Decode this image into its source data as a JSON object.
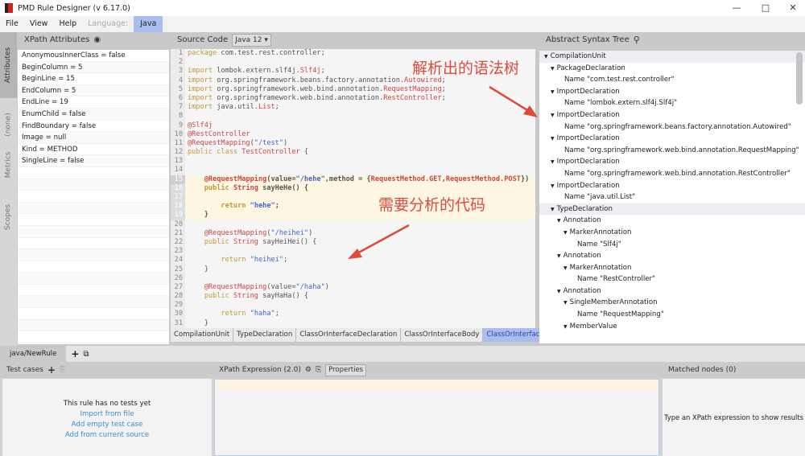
{
  "window": {
    "title": "PMD Rule Designer (v 6.17.0)"
  },
  "menu": {
    "file": "File",
    "view": "View",
    "help": "Help",
    "language_label": "Language:",
    "language": "Java"
  },
  "side_tabs": [
    "Attributes",
    "(none)",
    "Metrics",
    "Scopes"
  ],
  "attributes": {
    "title": "XPath Attributes",
    "items": [
      "AnonymousInnerClass = false",
      "BeginColumn = 5",
      "BeginLine = 15",
      "EndColumn = 5",
      "EndLine = 19",
      "EnumChild = false",
      "FindBoundary = false",
      "Image = null",
      "Kind = METHOD",
      "SingleLine = false"
    ]
  },
  "source": {
    "title": "Source Code",
    "version": "Java 12",
    "highlight_lines": [
      15,
      19
    ],
    "lines": [
      [
        [
          "package",
          "k"
        ],
        [
          " com.test.rest.controller;",
          "t"
        ]
      ],
      [],
      [
        [
          "import",
          "k"
        ],
        [
          " lombok.extern.slf4j.",
          "t"
        ],
        [
          "Slf4j",
          "a"
        ],
        [
          ";",
          "t"
        ]
      ],
      [
        [
          "import",
          "k"
        ],
        [
          " org.springframework.beans.factory.annotation.",
          "t"
        ],
        [
          "Autowired",
          "a"
        ],
        [
          ";",
          "t"
        ]
      ],
      [
        [
          "import",
          "k"
        ],
        [
          " org.springframework.web.bind.annotation.",
          "t"
        ],
        [
          "RequestMapping",
          "a"
        ],
        [
          ";",
          "t"
        ]
      ],
      [
        [
          "import",
          "k"
        ],
        [
          " org.springframework.web.bind.annotation.",
          "t"
        ],
        [
          "RestController",
          "a"
        ],
        [
          ";",
          "t"
        ]
      ],
      [
        [
          "import",
          "k"
        ],
        [
          " java.util.",
          "t"
        ],
        [
          "List",
          "a"
        ],
        [
          ";",
          "t"
        ]
      ],
      [],
      [
        [
          "@Slf4j",
          "a"
        ]
      ],
      [
        [
          "@RestController",
          "a"
        ]
      ],
      [
        [
          "@RequestMapping",
          "a"
        ],
        [
          "(",
          "t"
        ],
        [
          "\"/test\"",
          "s"
        ],
        [
          ")",
          "t"
        ]
      ],
      [
        [
          "public class",
          "k"
        ],
        [
          " ",
          "t"
        ],
        [
          "TestController",
          "a"
        ],
        [
          " {",
          "t"
        ]
      ],
      [],
      [],
      [
        [
          "    ",
          "t"
        ],
        [
          "@RequestMapping",
          "a"
        ],
        [
          "(value=",
          "t"
        ],
        [
          "\"/hehe\"",
          "s"
        ],
        [
          ",method = {",
          "t"
        ],
        [
          "RequestMethod.GET",
          "a"
        ],
        [
          ",",
          "t"
        ],
        [
          "RequestMethod.POST",
          "a"
        ],
        [
          "})",
          "t"
        ]
      ],
      [
        [
          "    ",
          "t"
        ],
        [
          "public",
          "k"
        ],
        [
          " ",
          "t"
        ],
        [
          "String",
          "a"
        ],
        [
          " sayHeHe() {",
          "t"
        ]
      ],
      [],
      [
        [
          "        ",
          "t"
        ],
        [
          "return",
          "k"
        ],
        [
          " ",
          "t"
        ],
        [
          "\"hehe\"",
          "s"
        ],
        [
          ";",
          "t"
        ]
      ],
      [
        [
          "    }",
          "t"
        ]
      ],
      [],
      [
        [
          "    ",
          "t"
        ],
        [
          "@RequestMapping",
          "a"
        ],
        [
          "(",
          "t"
        ],
        [
          "\"/heihei\"",
          "s"
        ],
        [
          ")",
          "t"
        ]
      ],
      [
        [
          "    ",
          "t"
        ],
        [
          "public",
          "k"
        ],
        [
          " ",
          "t"
        ],
        [
          "String",
          "a"
        ],
        [
          " sayHeiHei() {",
          "t"
        ]
      ],
      [],
      [
        [
          "        ",
          "t"
        ],
        [
          "return",
          "k"
        ],
        [
          " ",
          "t"
        ],
        [
          "\"heihei\"",
          "s"
        ],
        [
          ";",
          "t"
        ]
      ],
      [
        [
          "    }",
          "t"
        ]
      ],
      [],
      [
        [
          "    ",
          "t"
        ],
        [
          "@RequestMapping",
          "a"
        ],
        [
          "(value=",
          "t"
        ],
        [
          "\"/haha\"",
          "s"
        ],
        [
          ")",
          "t"
        ]
      ],
      [
        [
          "    ",
          "t"
        ],
        [
          "public",
          "k"
        ],
        [
          " ",
          "t"
        ],
        [
          "String",
          "a"
        ],
        [
          " sayHaHa() {",
          "t"
        ]
      ],
      [],
      [
        [
          "        ",
          "t"
        ],
        [
          "return",
          "k"
        ],
        [
          " ",
          "t"
        ],
        [
          "\"haha\"",
          "s"
        ],
        [
          ";",
          "t"
        ]
      ],
      [
        [
          "    }",
          "t"
        ]
      ]
    ],
    "breadcrumbs": [
      "CompilationUnit",
      "TypeDeclaration",
      "ClassOrInterfaceDeclaration",
      "ClassOrInterfaceBody",
      "ClassOrInterfaceBodyDeclaration"
    ]
  },
  "ast": {
    "title": "Abstract Syntax Tree",
    "nodes": [
      {
        "d": 0,
        "t": "CompilationUnit",
        "x": true,
        "sel": true
      },
      {
        "d": 1,
        "t": "PackageDeclaration",
        "x": true
      },
      {
        "d": 2,
        "t": "Name \"com.test.rest.controller\""
      },
      {
        "d": 1,
        "t": "ImportDeclaration",
        "x": true
      },
      {
        "d": 2,
        "t": "Name \"lombok.extern.slf4j.Slf4j\""
      },
      {
        "d": 1,
        "t": "ImportDeclaration",
        "x": true
      },
      {
        "d": 2,
        "t": "Name \"org.springframework.beans.factory.annotation.Autowired\""
      },
      {
        "d": 1,
        "t": "ImportDeclaration",
        "x": true
      },
      {
        "d": 2,
        "t": "Name \"org.springframework.web.bind.annotation.RequestMapping\""
      },
      {
        "d": 1,
        "t": "ImportDeclaration",
        "x": true
      },
      {
        "d": 2,
        "t": "Name \"org.springframework.web.bind.annotation.RestController\""
      },
      {
        "d": 1,
        "t": "ImportDeclaration",
        "x": true
      },
      {
        "d": 2,
        "t": "Name \"java.util.List\""
      },
      {
        "d": 1,
        "t": "TypeDeclaration",
        "x": true,
        "sel": true
      },
      {
        "d": 2,
        "t": "Annotation",
        "x": true
      },
      {
        "d": 3,
        "t": "MarkerAnnotation",
        "x": true
      },
      {
        "d": 4,
        "t": "Name \"Slf4j\""
      },
      {
        "d": 2,
        "t": "Annotation",
        "x": true
      },
      {
        "d": 3,
        "t": "MarkerAnnotation",
        "x": true
      },
      {
        "d": 4,
        "t": "Name \"RestController\""
      },
      {
        "d": 2,
        "t": "Annotation",
        "x": true
      },
      {
        "d": 3,
        "t": "SingleMemberAnnotation",
        "x": true
      },
      {
        "d": 4,
        "t": "Name \"RequestMapping\""
      },
      {
        "d": 3,
        "t": "MemberValue",
        "x": true
      }
    ]
  },
  "rule_tab": "java/NewRule",
  "tests": {
    "title": "Test cases",
    "empty": "This rule has no tests yet",
    "import": "Import from file",
    "add_empty": "Add empty test case",
    "add_current": "Add from current source"
  },
  "xpath": {
    "title": "XPath Expression (2.0)",
    "properties": "Properties",
    "value": ""
  },
  "matched": {
    "title": "Matched nodes (0)",
    "empty": "Type an XPath expression to show results"
  },
  "annotations": {
    "tree_note": "解析出的语法树",
    "code_note": "需要分析的代码",
    "color": "#e04a3a"
  }
}
